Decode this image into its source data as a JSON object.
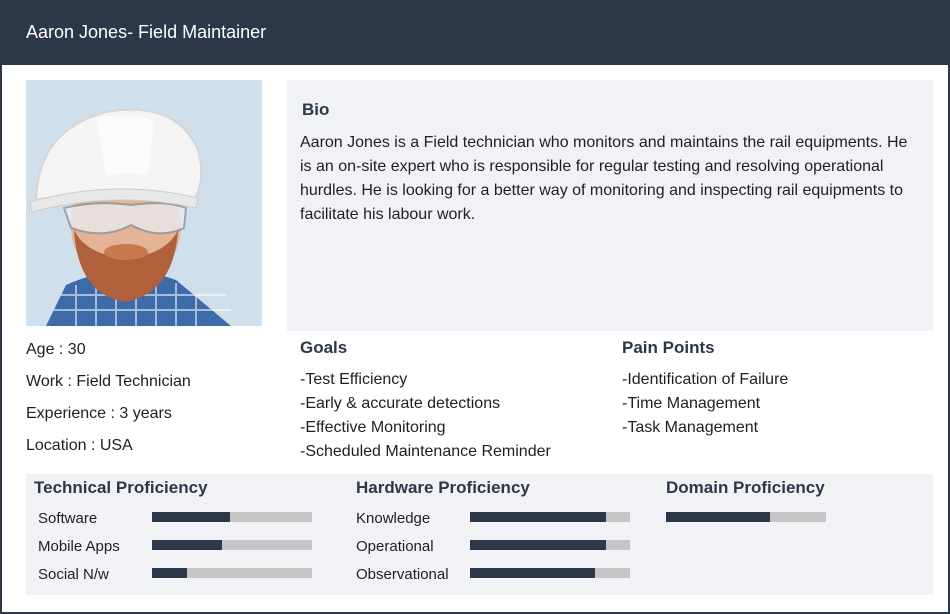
{
  "header": {
    "title": "Aaron Jones- Field Maintainer"
  },
  "photo": {
    "icon": "person-photo"
  },
  "bio": {
    "title": "Bio",
    "text": "Aaron Jones is a Field technician who monitors and maintains the rail equipments. He is an on-site expert who is responsible for regular testing and resolving operational hurdles. He is looking for a better way of monitoring and inspecting rail equipments to facilitate his labour work."
  },
  "info": {
    "age": "Age : 30",
    "work": "Work : Field Technician",
    "experience": "Experience : 3 years",
    "location": "Location : USA"
  },
  "goals": {
    "title": "Goals",
    "items": [
      "-Test Efficiency",
      "-Early & accurate detections",
      "-Effective Monitoring",
      "-Scheduled Maintenance Reminder"
    ]
  },
  "pain_points": {
    "title": "Pain Points",
    "items": [
      "-Identification of Failure",
      "-Time Management",
      "-Task Management"
    ]
  },
  "technical": {
    "title": "Technical Proficiency",
    "rows": [
      {
        "label": "Software",
        "level": 0.49
      },
      {
        "label": "Mobile Apps",
        "level": 0.44
      },
      {
        "label": "Social N/w",
        "level": 0.22
      }
    ]
  },
  "hardware": {
    "title": "Hardware Proficiency",
    "rows": [
      {
        "label": "Knowledge",
        "level": 0.85
      },
      {
        "label": "Operational",
        "level": 0.85
      },
      {
        "label": "Observational",
        "level": 0.78
      }
    ]
  },
  "domain": {
    "title": "Domain Proficiency",
    "level": 0.65
  },
  "colors": {
    "header_bg": "#2c3848",
    "bar_fill": "#2c3848",
    "bar_track": "#c6c6c6",
    "panel_bg": "#f0f2f5"
  }
}
